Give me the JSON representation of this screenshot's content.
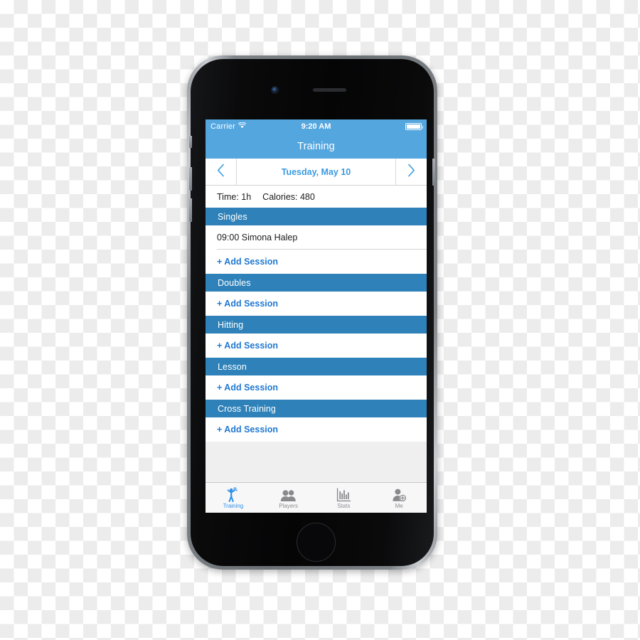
{
  "device": {
    "name": "iphone-6",
    "frame_color": "#7e8388",
    "body_color": "#0a0a0c"
  },
  "colors": {
    "nav_blue": "#54a6df",
    "section_blue": "#2f82b9",
    "link_blue": "#1f78d1",
    "date_blue": "#3a9ae0",
    "tab_active": "#2f90e8",
    "tab_inactive": "#8e8e93",
    "list_bg": "#efeff0"
  },
  "status_bar": {
    "carrier": "Carrier",
    "wifi_icon": "wifi-icon",
    "time": "9:20 AM",
    "battery_icon": "battery-full-icon"
  },
  "nav": {
    "title": "Training"
  },
  "date_bar": {
    "prev_icon": "chevron-left-icon",
    "next_icon": "chevron-right-icon",
    "date": "Tuesday, May 10"
  },
  "summary": {
    "time": "Time: 1h",
    "calories": "Calories: 480"
  },
  "sections": [
    {
      "title": "Singles",
      "rows": [
        {
          "label": "09:00 Simona Halep",
          "type": "session"
        },
        {
          "label": "+ Add Session",
          "type": "add"
        }
      ]
    },
    {
      "title": "Doubles",
      "rows": [
        {
          "label": "+ Add Session",
          "type": "add"
        }
      ]
    },
    {
      "title": "Hitting",
      "rows": [
        {
          "label": "+ Add Session",
          "type": "add"
        }
      ]
    },
    {
      "title": "Lesson",
      "rows": [
        {
          "label": "+ Add Session",
          "type": "add"
        }
      ]
    },
    {
      "title": "Cross Training",
      "rows": [
        {
          "label": "+ Add Session",
          "type": "add"
        }
      ]
    }
  ],
  "tabs": [
    {
      "label": "Training",
      "icon": "tennis-player-icon",
      "active": true
    },
    {
      "label": "Players",
      "icon": "people-icon",
      "active": false
    },
    {
      "label": "Stats",
      "icon": "bar-chart-icon",
      "active": false
    },
    {
      "label": "Me",
      "icon": "person-add-icon",
      "active": false
    }
  ]
}
